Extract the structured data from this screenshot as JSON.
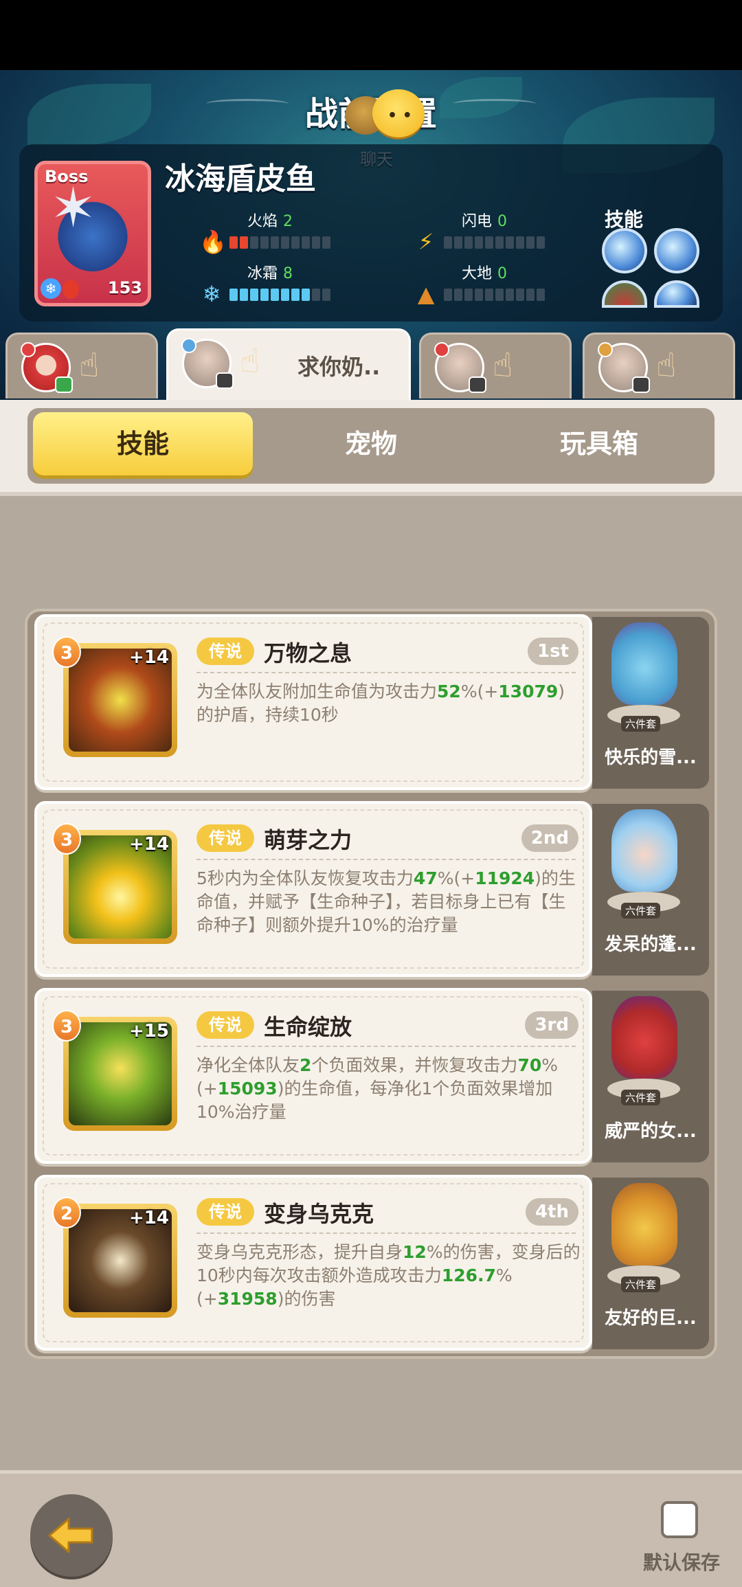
{
  "header": {
    "title": "战前配置",
    "chat_label": "聊天"
  },
  "boss": {
    "tag": "Boss",
    "name": "冰海盾皮鱼",
    "level": "153",
    "skills_label": "技能",
    "stats": [
      {
        "label": "火焰",
        "value": "2",
        "color": "red"
      },
      {
        "label": "闪电",
        "value": "0",
        "color": "green"
      },
      {
        "label": "冰霜",
        "value": "8",
        "color": "blue"
      },
      {
        "label": "大地",
        "value": "0",
        "color": "green"
      }
    ]
  },
  "players": [
    {
      "name": ""
    },
    {
      "name": "求你奶.."
    },
    {
      "name": ""
    },
    {
      "name": ""
    }
  ],
  "tabs": [
    {
      "label": "技能"
    },
    {
      "label": "宠物"
    },
    {
      "label": "玩具箱"
    }
  ],
  "skills": [
    {
      "level": "3",
      "plus": "+14",
      "rarity": "传说",
      "name": "万物之息",
      "rank": "1st",
      "desc": [
        {
          "t": "为全体队友附加生命值为攻击力"
        },
        {
          "t": "52",
          "g": true
        },
        {
          "t": "%(+"
        },
        {
          "t": "13079",
          "g": true
        },
        {
          "t": ")的护盾，持续10秒"
        }
      ],
      "side_name": "快乐的雪...",
      "set_label": "六件套"
    },
    {
      "level": "3",
      "plus": "+14",
      "rarity": "传说",
      "name": "萌芽之力",
      "rank": "2nd",
      "desc": [
        {
          "t": "5秒内为全体队友恢复攻击力"
        },
        {
          "t": "47",
          "g": true
        },
        {
          "t": "%(+"
        },
        {
          "t": "11924",
          "g": true
        },
        {
          "t": ")的生命值，并赋予【生命种子】，若目标身上已有【生命种子】则额外提升10%的治疗量"
        }
      ],
      "side_name": "发呆的蓬...",
      "set_label": "六件套"
    },
    {
      "level": "3",
      "plus": "+15",
      "rarity": "传说",
      "name": "生命绽放",
      "rank": "3rd",
      "desc": [
        {
          "t": "净化全体队友"
        },
        {
          "t": "2",
          "g": true
        },
        {
          "t": "个负面效果，并恢复攻击力"
        },
        {
          "t": "70",
          "g": true
        },
        {
          "t": "%(+"
        },
        {
          "t": "15093",
          "g": true
        },
        {
          "t": ")的生命值，每净化1个负面效果增加10%治疗量"
        }
      ],
      "side_name": "威严的女...",
      "set_label": "六件套"
    },
    {
      "level": "2",
      "plus": "+14",
      "rarity": "传说",
      "name": "变身乌克克",
      "rank": "4th",
      "desc": [
        {
          "t": "变身乌克克形态，提升自身"
        },
        {
          "t": "12",
          "g": true
        },
        {
          "t": "%的伤害，变身后的10秒内每次攻击额外造成攻击力"
        },
        {
          "t": "126.7",
          "g": true
        },
        {
          "t": "%(+"
        },
        {
          "t": "31958",
          "g": true
        },
        {
          "t": ")的伤害"
        }
      ],
      "side_name": "友好的巨...",
      "set_label": "六件套"
    }
  ],
  "footer": {
    "save_label": "默认保存"
  }
}
